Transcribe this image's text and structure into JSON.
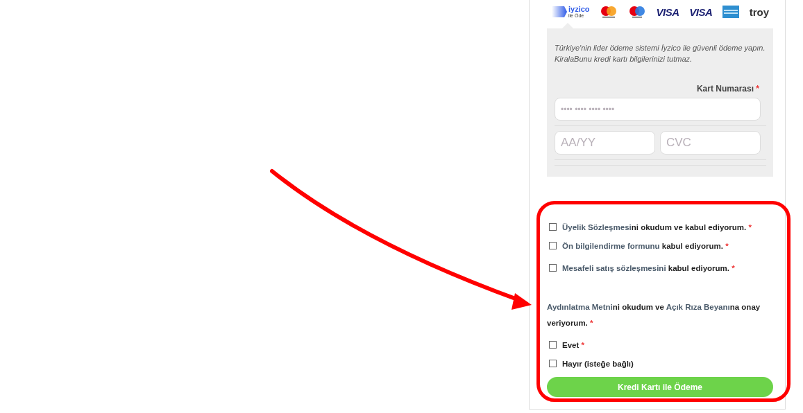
{
  "payment_logos": [
    {
      "kind": "iyzico",
      "text": "iyzico",
      "subtext": "ile Öde"
    },
    {
      "kind": "mastercard"
    },
    {
      "kind": "maestro"
    },
    {
      "kind": "visa",
      "text": "VISA"
    },
    {
      "kind": "visa",
      "text": "VISA"
    },
    {
      "kind": "amex"
    },
    {
      "kind": "troy",
      "text": "troy"
    }
  ],
  "info_text": "Türkiye'nin lider ödeme sistemi İyzico ile güvenli ödeme yapın. KiralaBunu kredi kartı bilgilerinizi tutmaz.",
  "card_number": {
    "label": "Kart Numarası",
    "required_mark": "*",
    "placeholder": "•••• •••• •••• ••••"
  },
  "expiry": {
    "placeholder": "AA/YY"
  },
  "cvc": {
    "placeholder": "CVC"
  },
  "consents": [
    {
      "kind": "checkbox",
      "checked": false,
      "parts": [
        {
          "text": "Üyelik Sözleşmesi",
          "kind": "link"
        },
        {
          "text": "ni okudum ve kabul ediyorum.",
          "kind": "plain"
        },
        {
          "text": "*",
          "kind": "required"
        }
      ]
    },
    {
      "kind": "checkbox",
      "checked": false,
      "parts": [
        {
          "text": "Ön bilgilendirme formunu",
          "kind": "link"
        },
        {
          "text": "kabul ediyorum.",
          "kind": "plain"
        },
        {
          "text": "*",
          "kind": "required"
        }
      ]
    },
    {
      "kind": "checkbox",
      "checked": false,
      "parts": [
        {
          "text": "Mesafeli satış sözleşmesini",
          "kind": "link"
        },
        {
          "text": "kabul ediyorum.",
          "kind": "plain"
        },
        {
          "text": "*",
          "kind": "required"
        }
      ]
    },
    {
      "kind": "statement",
      "parts": [
        {
          "text": "Aydınlatma Metni",
          "kind": "link"
        },
        {
          "text": "ni okudum ve",
          "kind": "plain"
        },
        {
          "text": "Açık Rıza Beyanı",
          "kind": "link"
        },
        {
          "text": "na onay veriyorum.",
          "kind": "plain"
        },
        {
          "text": "*",
          "kind": "required"
        }
      ]
    },
    {
      "kind": "checkbox",
      "checked": false,
      "parts": [
        {
          "text": "Evet",
          "kind": "plain"
        },
        {
          "text": "*",
          "kind": "required"
        }
      ]
    },
    {
      "kind": "checkbox",
      "checked": false,
      "parts": [
        {
          "text": "Hayır (isteğe bağlı)",
          "kind": "plain"
        }
      ]
    }
  ],
  "submit_button": "Kredi Kartı ile Ödeme"
}
